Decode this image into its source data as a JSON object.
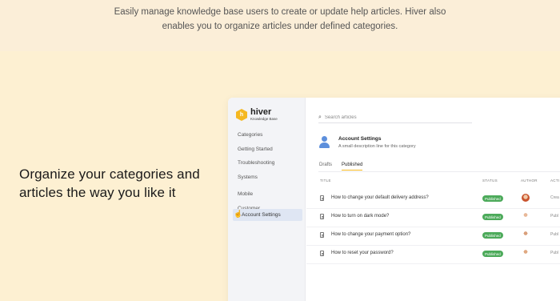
{
  "intro": {
    "line1": "Easily manage knowledge base users to create or update help articles. Hiver also",
    "line2": "enables you to organize articles under defined categories."
  },
  "heading": {
    "line1": "Organize your categories and",
    "line2": "articles the way you like it"
  },
  "app": {
    "brand": {
      "name": "hiver",
      "sub": "Knowledge Base",
      "icon": "hiver-hex-logo"
    },
    "sidebar": {
      "items": [
        "Categories",
        "Getting Started",
        "Troubleshooting",
        "Systems",
        "Mobile",
        "Customer"
      ],
      "active": "Account Settings"
    },
    "search": {
      "placeholder": "Search articles"
    },
    "category": {
      "title": "Account Settings",
      "description": "A small description line for this category"
    },
    "tabs": [
      "Drafts",
      "Published"
    ],
    "table": {
      "headers": [
        "TITLE",
        "STATUS",
        "AUTHOR",
        "ACTI"
      ],
      "rows": [
        {
          "title": "How to change your default delivery address?",
          "status": "Published",
          "action": "Crea"
        },
        {
          "title": "How to turn on dark mode?",
          "status": "Published",
          "action": "Publ"
        },
        {
          "title": "How to change your payment option?",
          "status": "Published",
          "action": "Publ"
        },
        {
          "title": "How to reset your password?",
          "status": "Published",
          "action": "Publ"
        }
      ]
    },
    "colors": {
      "accent": "#f5b821",
      "published": "#4caa5a",
      "background": "#fdf0d2"
    }
  }
}
